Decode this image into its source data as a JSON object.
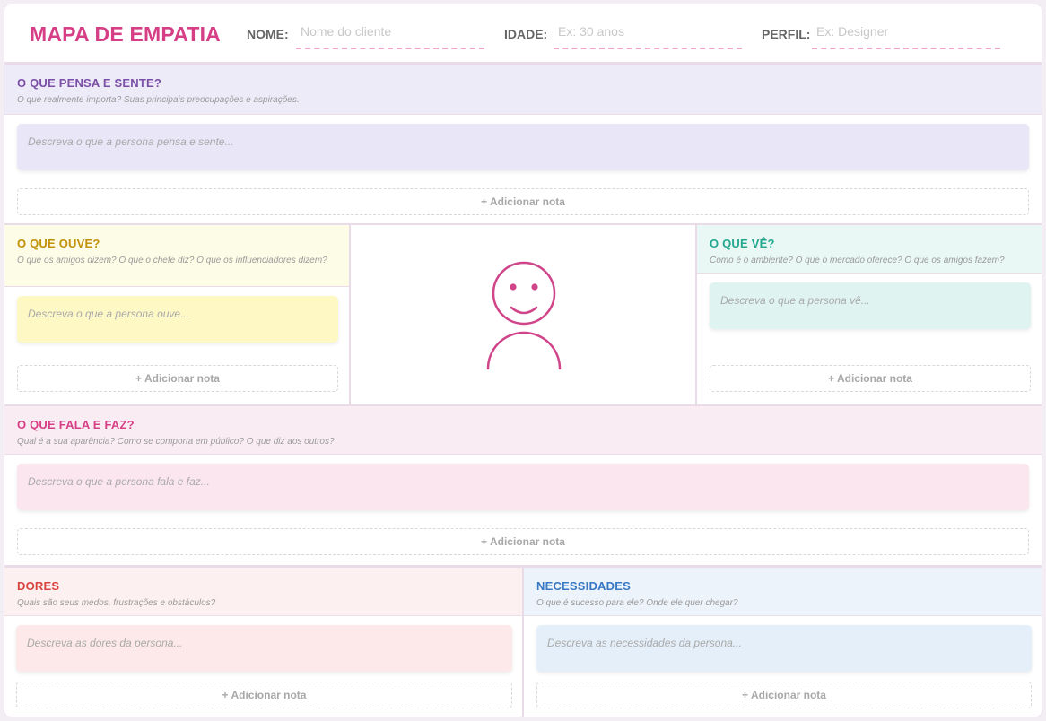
{
  "header": {
    "title": "MAPA DE EMPATIA",
    "fields": [
      {
        "label": "NOME:",
        "placeholder": "Nome do cliente"
      },
      {
        "label": "IDADE:",
        "placeholder": "Ex: 30 anos"
      },
      {
        "label": "PERFIL:",
        "placeholder": "Ex: Designer"
      }
    ]
  },
  "sections": {
    "pensa": {
      "title": "O QUE PENSA E SENTE?",
      "subtitle": "O que realmente importa? Suas principais preocupações e aspirações.",
      "note_placeholder": "Descreva o que a persona pensa e sente...",
      "add_label": "+ Adicionar nota",
      "color": "#7a4fa6"
    },
    "ouve": {
      "title": "O QUE OUVE?",
      "subtitle": "O que os amigos dizem? O que o chefe diz? O que os influenciadores dizem?",
      "note_placeholder": "Descreva o que a persona ouve...",
      "add_label": "+ Adicionar nota",
      "color": "#c29009"
    },
    "ve": {
      "title": "O QUE VÊ?",
      "subtitle": "Como é o ambiente? O que o mercado oferece? O que os amigos fazem?",
      "note_placeholder": "Descreva o que a persona vê...",
      "add_label": "+ Adicionar nota",
      "color": "#23a890"
    },
    "fala": {
      "title": "O QUE FALA E FAZ?",
      "subtitle": "Qual é a sua aparência? Como se comporta em público? O que diz aos outros?",
      "note_placeholder": "Descreva o que a persona fala e faz...",
      "add_label": "+ Adicionar nota",
      "color": "#d63f86"
    },
    "dores": {
      "title": "DORES",
      "subtitle": "Quais são seus medos, frustrações e obstáculos?",
      "note_placeholder": "Descreva as dores da persona...",
      "add_label": "+ Adicionar nota",
      "color": "#d9433f"
    },
    "necessidades": {
      "title": "NECESSIDADES",
      "subtitle": "O que é sucesso para ele? Onde ele quer chegar?",
      "note_placeholder": "Descreva as necessidades da persona...",
      "add_label": "+ Adicionar nota",
      "color": "#3779c4"
    }
  },
  "persona_icon": {
    "name": "smiley-person-icon",
    "color": "#d0458a"
  },
  "colors": {
    "accent": "#d63f86",
    "note_pensa": "#e9e6f7",
    "note_ouve": "#fdf8c4",
    "note_ve": "#dff4f0",
    "note_fala": "#fbe5ef",
    "note_dores": "#fde9e9",
    "note_necessidades": "#e4eff9"
  }
}
